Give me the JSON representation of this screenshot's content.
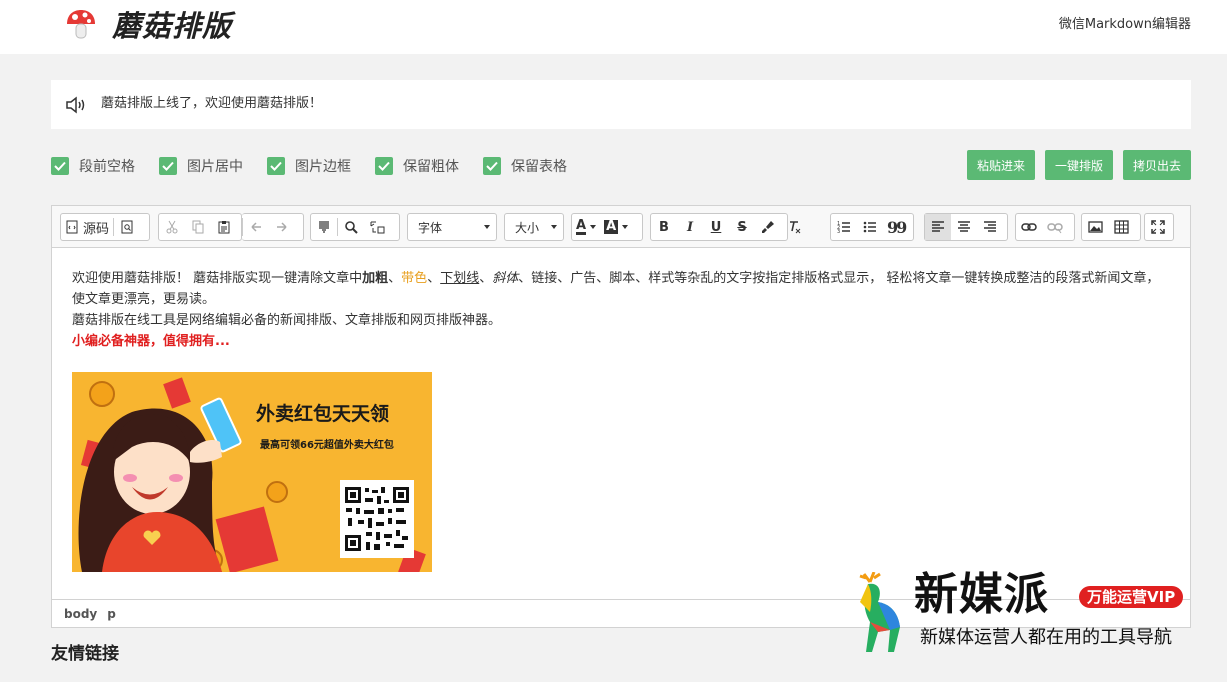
{
  "header": {
    "brand": "蘑菇排版",
    "top_link": "微信Markdown编辑器"
  },
  "notice": {
    "text": "蘑菇排版上线了，欢迎使用蘑菇排版！"
  },
  "options": [
    {
      "label": "段前空格",
      "checked": true
    },
    {
      "label": "图片居中",
      "checked": true
    },
    {
      "label": "图片边框",
      "checked": true
    },
    {
      "label": "保留粗体",
      "checked": true
    },
    {
      "label": "保留表格",
      "checked": true
    }
  ],
  "actions": {
    "paste": "粘贴进来",
    "format": "一键排版",
    "copy": "拷贝出去"
  },
  "toolbar": {
    "source": "源码",
    "font": "字体",
    "size": "大小",
    "color_letter": "A",
    "bg_letter": "A",
    "bold": "B",
    "italic": "I",
    "underline": "U",
    "strike": "S",
    "quote": "99"
  },
  "content": {
    "p1_a": "欢迎使用蘑菇排版！ 蘑菇排版实现一键清除文章中",
    "p1_bold": "加粗",
    "p1_sep1": "、",
    "p1_color": "带色",
    "p1_sep2": "、",
    "p1_underline": "下划线",
    "p1_sep3": "、",
    "p1_italic": "斜体",
    "p1_b": "、链接、广告、脚本、样式等杂乱的文字按指定排版格式显示， 轻松将文章一键转换成整洁的段落式新闻文章，使文章更漂亮，更易读。",
    "p2": "蘑菇排版在线工具是网络编辑必备的新闻排版、文章排版和网页排版神器。",
    "p3": "小编必备神器，值得拥有..."
  },
  "banner": {
    "title": "外卖红包天天领",
    "subtitle": "最高可领66元超值外卖大红包"
  },
  "statusbar": {
    "path1": "body",
    "path2": "p"
  },
  "footer": {
    "friends": "友情链接"
  },
  "watermark": {
    "title": "新媒派",
    "badge": "万能运营VIP",
    "subtitle": "新媒体运营人都在用的工具导航"
  },
  "colors": {
    "accent_green": "#5bb974",
    "highlight_red": "#e02020",
    "banner_bg": "#f8b530"
  }
}
